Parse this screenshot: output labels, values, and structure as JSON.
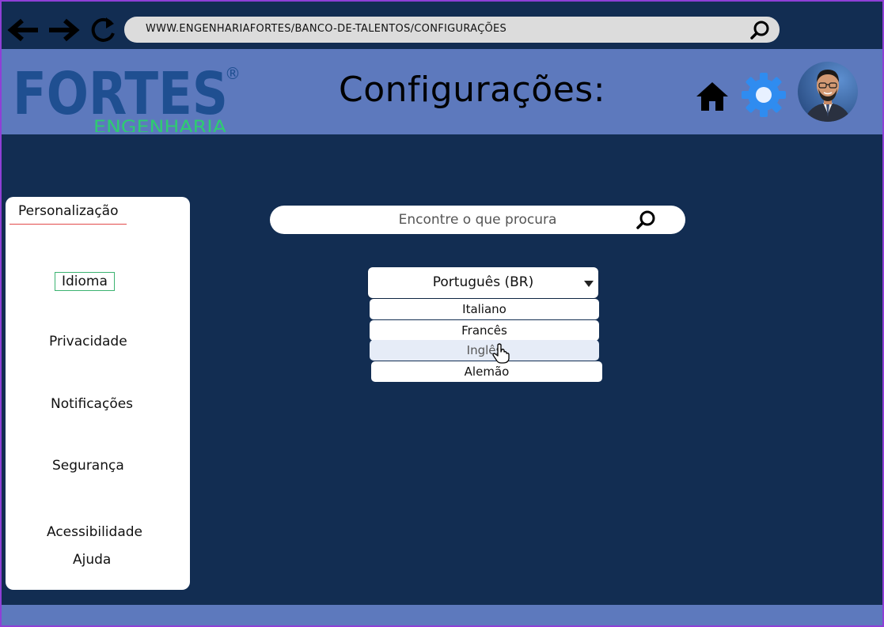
{
  "browser": {
    "back_icon": "arrow-left-icon",
    "forward_icon": "arrow-right-icon",
    "reload_icon": "reload-icon",
    "url": "WWW.ENGENHARIAFORTES/BANCO-DE-TALENTOS/CONFIGURAÇÕES",
    "search_icon": "search-icon"
  },
  "header": {
    "logo": {
      "main_text": "FORTES",
      "sub_text": "ENGENHARIA",
      "registered_mark": "®"
    },
    "title": "Configurações:",
    "icons": [
      "home-icon",
      "gear-icon",
      "avatar"
    ]
  },
  "sidebar": {
    "title": "Personalização",
    "items": [
      {
        "label": "Idioma",
        "active": true
      },
      {
        "label": "Privacidade",
        "active": false
      },
      {
        "label": "Notificações",
        "active": false
      },
      {
        "label": "Segurança",
        "active": false
      },
      {
        "label": "Acessibilidade",
        "active": false
      },
      {
        "label": "Ajuda",
        "active": false
      }
    ]
  },
  "search": {
    "placeholder": "Encontre o que procura"
  },
  "language_select": {
    "selected": "Português (BR)",
    "options": [
      {
        "label": "Italiano",
        "hovered": false
      },
      {
        "label": "Francês",
        "hovered": false
      },
      {
        "label": "Inglês",
        "hovered": true
      },
      {
        "label": "Alemão",
        "hovered": false
      }
    ]
  },
  "colors": {
    "background": "#122d52",
    "header": "#5d79bd",
    "logo_blue": "#1f4f91",
    "logo_green": "#2ecc71",
    "gear_blue": "#2f8cf0",
    "active_border": "#3cb371",
    "underline_red": "#e24a4a",
    "frame": "#8e3fd6"
  }
}
